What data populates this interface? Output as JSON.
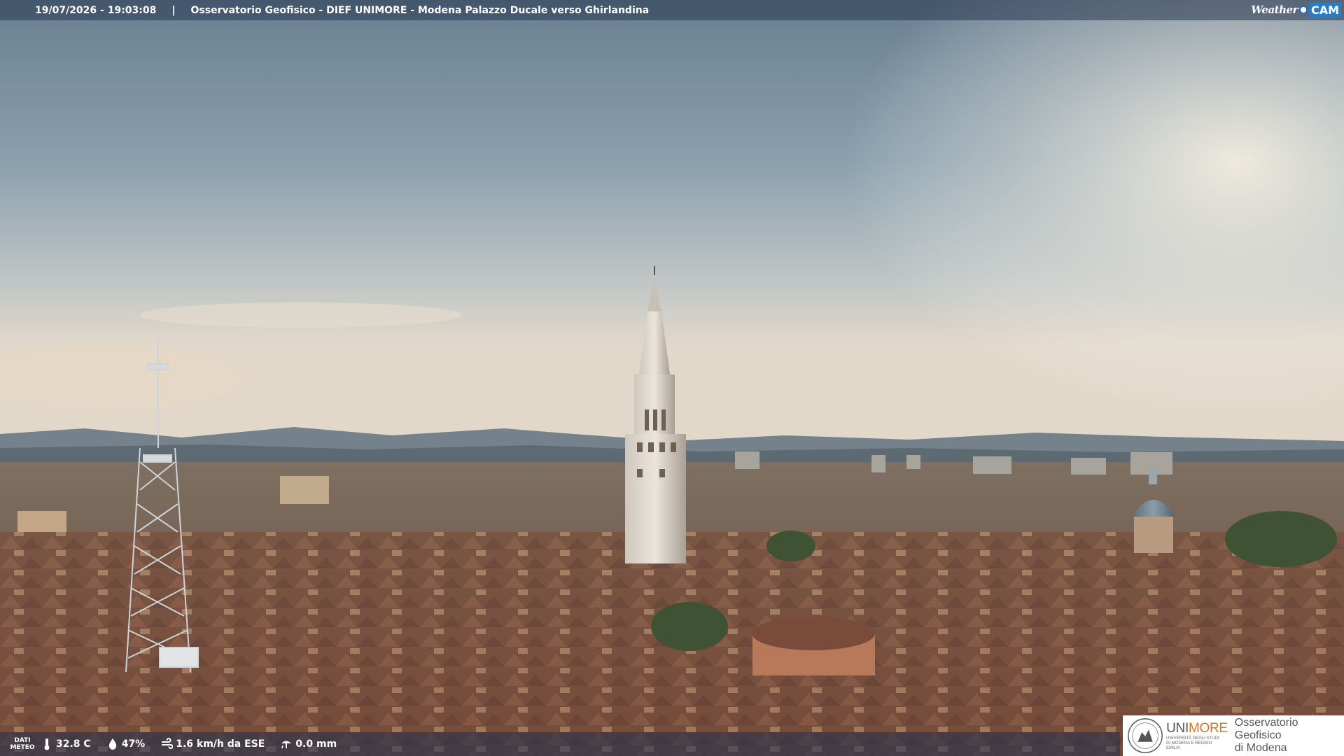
{
  "overlay": {
    "timestamp": "19/07/2026 - 19:03:08",
    "separator": "|",
    "title": "Osservatorio Geofisico - DIEF UNIMORE - Modena Palazzo Ducale verso Ghirlandina",
    "brand_weather": "Weather",
    "brand_cam": "CAM"
  },
  "weather": {
    "label_line1": "DATI",
    "label_line2": "METEO",
    "temperature": "32.8 C",
    "humidity": "47%",
    "wind": "1.6 km/h da ESE",
    "rain": "0.0 mm",
    "icons": [
      "thermometer-icon",
      "humidity-drop-icon",
      "wind-icon",
      "rain-gauge-icon"
    ]
  },
  "logo": {
    "uni_part1": "UNI",
    "uni_part2": "MORE",
    "uni_sub": "UNIVERSITÀ DEGLI STUDI DI MODENA E REGGIO EMILIA",
    "obs_line1": "Osservatorio Geofisico",
    "obs_line2": "di Modena"
  },
  "colors": {
    "unimore_orange": "#d8752b",
    "weathercam_blue": "#2a7dc4",
    "sky_top": "#6f8697",
    "roof_terracotta": "#8a5a42"
  }
}
